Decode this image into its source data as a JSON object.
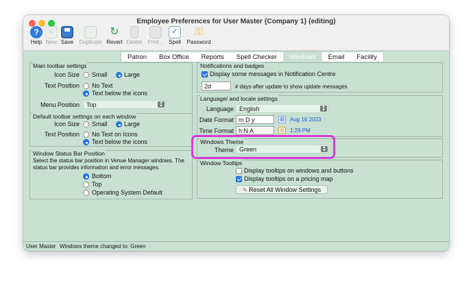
{
  "window": {
    "title": "Employee Preferences for User Master {Company 1} (editing)"
  },
  "toolbar": [
    {
      "label": "Help",
      "icon": "help-icon",
      "color": "#2f7be0",
      "enabled": true
    },
    {
      "label": "New",
      "icon": "new-icon",
      "color": "#5fbf6a",
      "enabled": false
    },
    {
      "label": "Save",
      "icon": "save-icon",
      "color": "#3b7fd1",
      "enabled": true
    },
    {
      "label": "Duplicate",
      "icon": "duplicate-icon",
      "color": "#6bb86b",
      "enabled": false
    },
    {
      "label": "Revert",
      "icon": "revert-icon",
      "color": "#2fa14a",
      "enabled": true
    },
    {
      "label": "Delete",
      "icon": "delete-icon",
      "color": "#9aa0a6",
      "enabled": false
    },
    {
      "label": "Print...",
      "icon": "print-icon",
      "color": "#9aa0a6",
      "enabled": false
    },
    {
      "label": "Spell",
      "icon": "spell-icon",
      "color": "#5a8fd6",
      "enabled": true
    },
    {
      "label": "Password",
      "icon": "key-icon",
      "color": "#e6b422",
      "enabled": true
    }
  ],
  "tabs": [
    {
      "label": "Patron",
      "active": false
    },
    {
      "label": "Box Office",
      "active": false
    },
    {
      "label": "Reports",
      "active": false
    },
    {
      "label": "Spell Checker",
      "active": false
    },
    {
      "label": "Windows",
      "active": true
    },
    {
      "label": "Email",
      "active": false
    },
    {
      "label": "Facility",
      "active": false
    }
  ],
  "main_toolbar": {
    "title": "Main toolbar settings",
    "icon_size_label": "Icon Size",
    "small": "Small",
    "large": "Large",
    "text_position_label": "Text Position",
    "no_text": "No Text",
    "text_below": "Text below the icons",
    "menu_position_label": "Menu Position",
    "menu_position_value": "Top"
  },
  "default_toolbar": {
    "title": "Default toolbar settings on each window",
    "icon_size_label": "Icon Size",
    "small": "Small",
    "large": "Large",
    "text_position_label": "Text Position",
    "no_text": "No Text on Icons",
    "text_below": "Text below the icons"
  },
  "status_bar_position": {
    "title": "Window Status Bar Position",
    "description": "Select the status bar position in Venue Manager windows.  The status bar provides information and error messages.",
    "bottom": "Bottom",
    "top": "Top",
    "os_default": "Operating System Default"
  },
  "notifications": {
    "title": "Notifications and badges",
    "display_label": "Display some messages in Notification Centre",
    "days_value": "2d",
    "days_label": "# days after update to show update messages"
  },
  "locale": {
    "title": "Language/ and locale settings",
    "language_label": "Language",
    "language_value": "English",
    "date_format_label": "Date Format",
    "date_format_value": "m D y",
    "date_example": "Aug 16 2023",
    "time_format_label": "Time Format",
    "time_format_value": "h:N A",
    "time_example": "1:29 PM"
  },
  "theme": {
    "title": "Windows Theme",
    "theme_label": "Theme",
    "theme_value": "Green"
  },
  "tooltips": {
    "title": "Window Tooltips",
    "on_windows": "Display tooltips on windows and buttons",
    "on_pricing": "Display tooltips on a pricing map",
    "reset_button": "Reset All Window Settings"
  },
  "statusbar": {
    "user": "User Master",
    "message": "Windows theme changed to: Green"
  },
  "colors": {
    "background": "#c8e1d3",
    "highlight": "#d63bd6"
  }
}
